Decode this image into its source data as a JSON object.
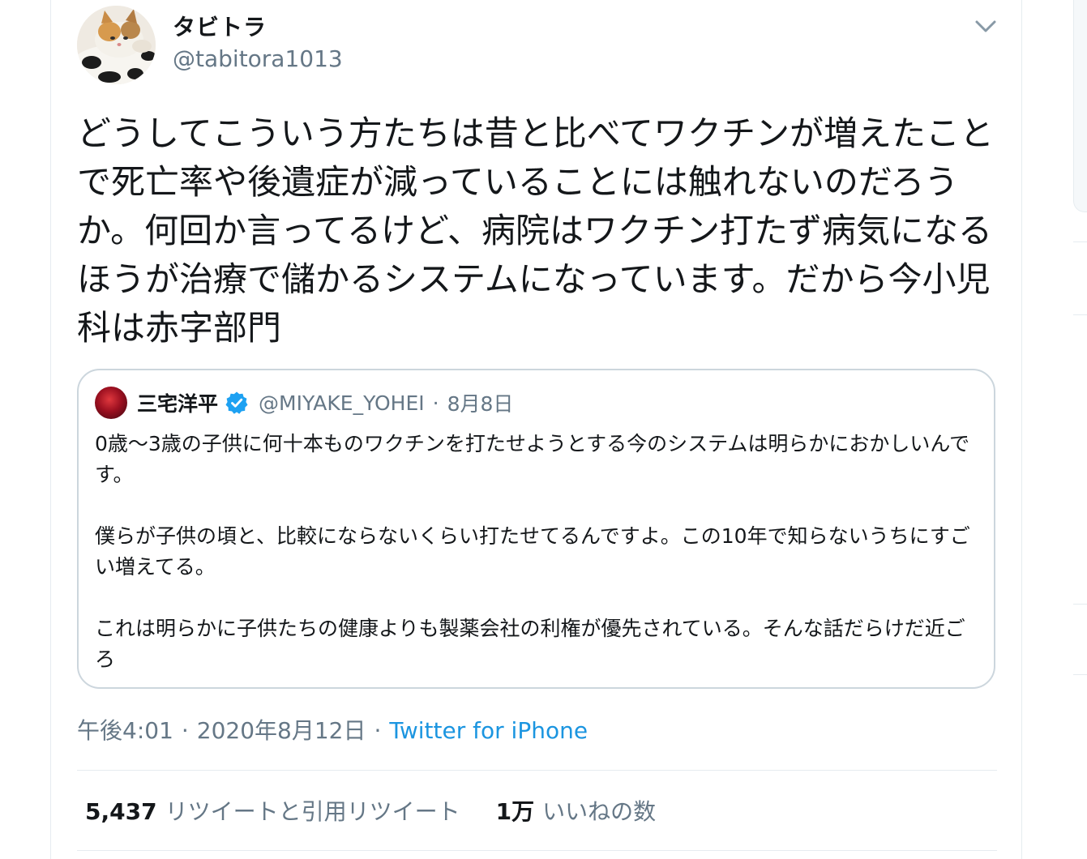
{
  "tweet": {
    "display_name": "タビトラ",
    "handle": "@tabitora1013",
    "text": "どうしてこういう方たちは昔と比べてワクチンが増えたことで死亡率や後遺症が減っていることには触れないのだろうか。何回か言ってるけど、病院はワクチン打たず病気になるほうが治療で儲かるシステムになっています。だから今小児科は赤字部門",
    "time": "午後4:01",
    "date": "2020年8月12日",
    "separator": "·",
    "source": "Twitter for iPhone"
  },
  "quoted": {
    "name": "三宅洋平",
    "handle": "@MIYAKE_YOHEI",
    "separator": "·",
    "date": "8月8日",
    "text": "0歳〜3歳の子供に何十本ものワクチンを打たせようとする今のシステムは明らかにおかしいんです。\n\n僕らが子供の頃と、比較にならないくらい打たせてるんですよ。この10年で知らないうちにすごい増えてる。\n\nこれは明らかに子供たちの健康よりも製薬会社の利権が優先されている。そんな話だらけだ近ごろ"
  },
  "stats": {
    "retweets_count": "5,437",
    "retweets_label": "リツイートと引用リツイート",
    "likes_count": "1万",
    "likes_label": "いいねの数"
  },
  "icons": {
    "caret": "chevron-down-icon",
    "verified": "verified-badge-icon"
  },
  "colors": {
    "accent": "#1b95e0",
    "secondary_text": "#657786",
    "primary_text": "#14171a",
    "border": "#ccd6dd",
    "verified": "#1da1f2"
  }
}
